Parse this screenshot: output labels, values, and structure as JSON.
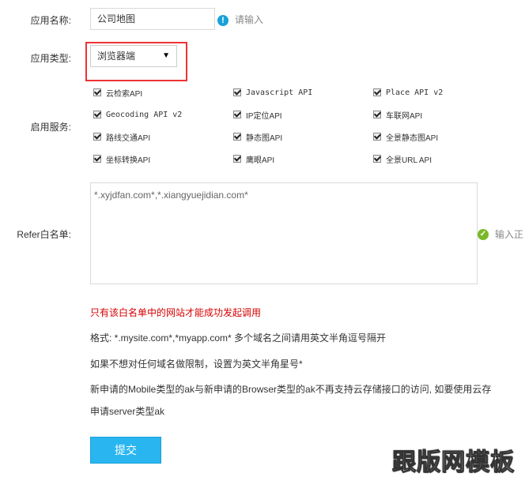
{
  "form": {
    "app_name_label": "应用名称:",
    "app_name_value": "公司地图",
    "app_name_hint": "请输入",
    "app_type_label": "应用类型:",
    "app_type_value": "浏览器端",
    "services_label": "启用服务:",
    "services": [
      {
        "label": "云检索API",
        "checked": true
      },
      {
        "label": "Javascript API",
        "checked": true
      },
      {
        "label": "Place API v2",
        "checked": true
      },
      {
        "label": "Geocoding API v2",
        "checked": true
      },
      {
        "label": "IP定位API",
        "checked": true
      },
      {
        "label": "车联网API",
        "checked": true
      },
      {
        "label": "路线交通API",
        "checked": true
      },
      {
        "label": "静态图API",
        "checked": true
      },
      {
        "label": "全景静态图API",
        "checked": true
      },
      {
        "label": "坐标转换API",
        "checked": true
      },
      {
        "label": "鹰眼API",
        "checked": true
      },
      {
        "label": "全景URL API",
        "checked": true
      }
    ],
    "refer_label": "Refer白名单:",
    "refer_value": "*.xyjdfan.com*,*.xiangyuejidian.com*",
    "refer_hint": "输入正",
    "notes": {
      "warning": "只有该白名单中的网站才能成功发起调用",
      "format": "格式: *.mysite.com*,*myapp.com* 多个域名之间请用英文半角逗号隔开",
      "no_limit": "如果不想对任何域名做限制，设置为英文半角星号*",
      "mobile": "新申请的Mobile类型的ak与新申请的Browser类型的ak不再支持云存储接口的访问, 如要使用云存",
      "server": "申请server类型ak"
    },
    "submit_label": "提交"
  },
  "watermark": "跟版网模板",
  "colors": {
    "accent": "#29b6f0",
    "highlight_border": "#e33333",
    "warning_text": "#d60000",
    "ok_icon": "#7ab829",
    "info_icon": "#19a1d9"
  }
}
